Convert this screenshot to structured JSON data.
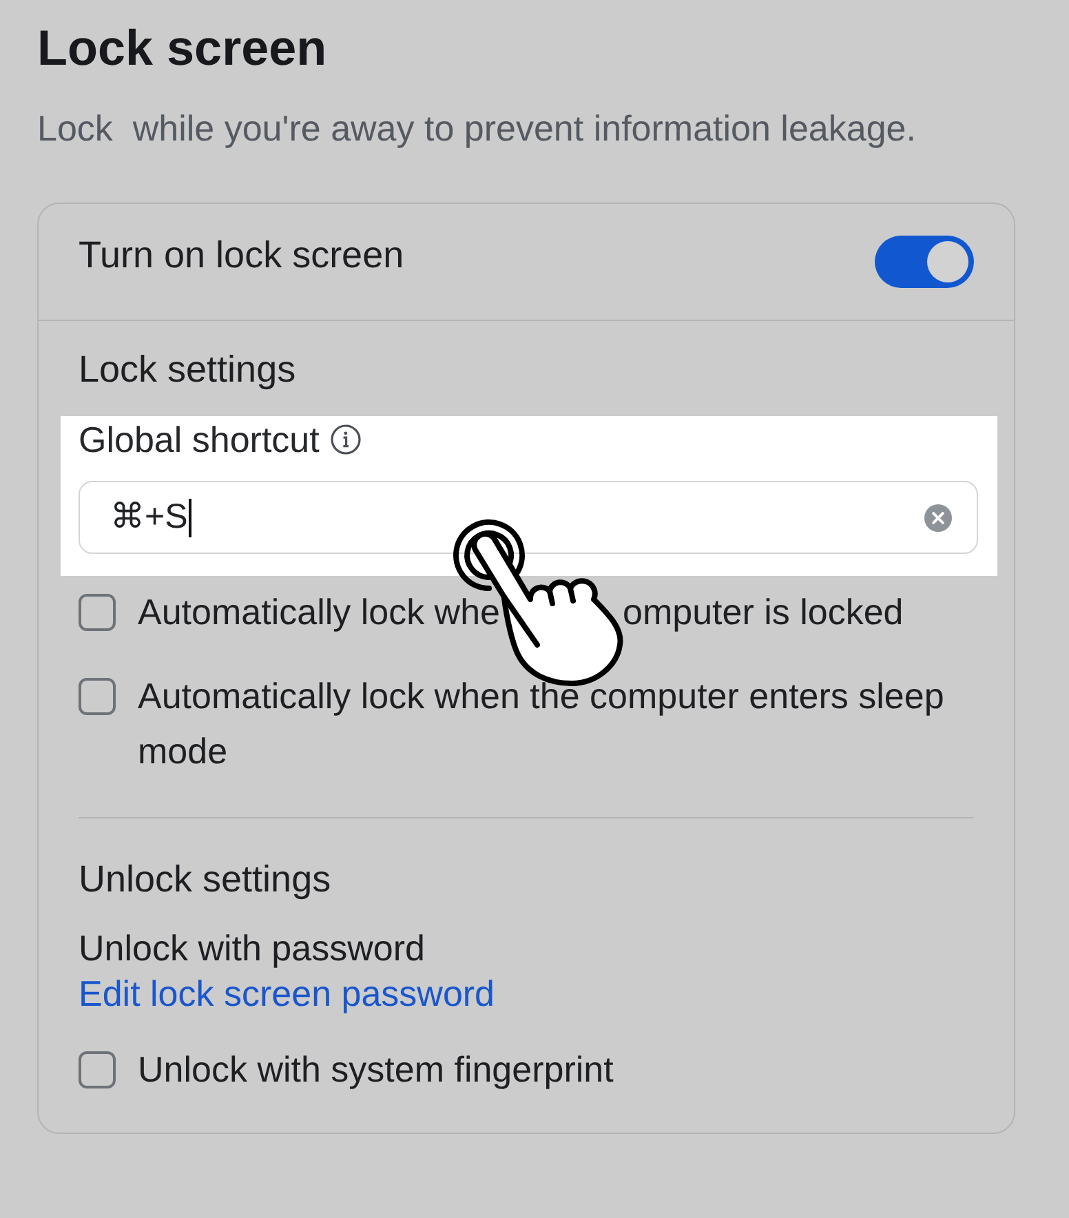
{
  "page": {
    "title": "Lock screen",
    "subtitle": "Lock  while you're away to prevent information leakage."
  },
  "card": {
    "main_toggle": {
      "label": "Turn on lock screen",
      "on": true
    },
    "lock_settings": {
      "heading": "Lock settings",
      "shortcut": {
        "label": "Global shortcut",
        "value": "⌘+S",
        "spotlight": true
      },
      "options": [
        {
          "label_parts": [
            "Automatically lock whe",
            "omputer is locked"
          ],
          "checked": false
        },
        {
          "label_parts": [
            "Automatically lock when the computer enters sleep mode"
          ],
          "checked": false
        }
      ]
    },
    "unlock_settings": {
      "heading": "Unlock settings",
      "password_label": "Unlock with password",
      "password_link": "Edit lock screen password",
      "options": [
        {
          "label_parts": [
            "Unlock with system fingerprint"
          ],
          "checked": false
        }
      ]
    }
  }
}
